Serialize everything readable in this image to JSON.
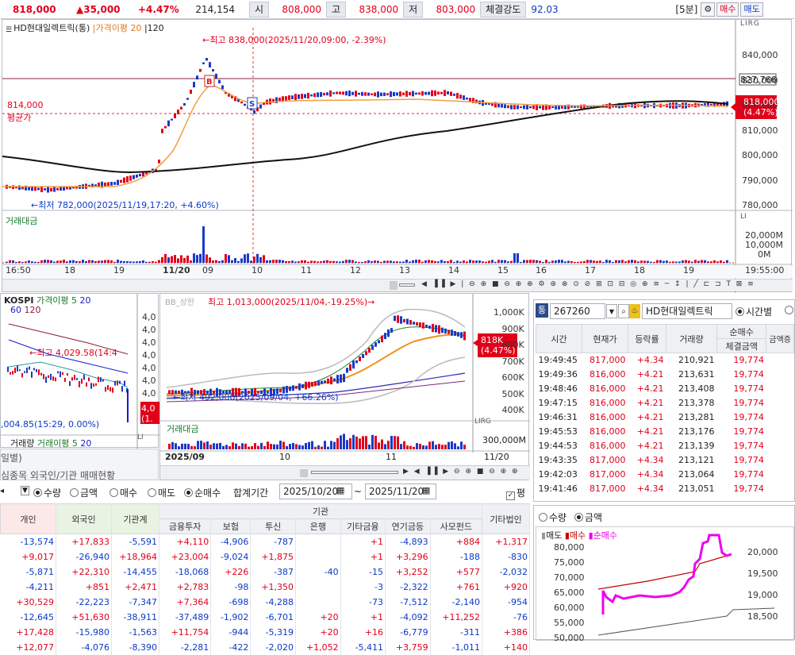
{
  "topbar": {
    "price": "818,000",
    "change": "▲35,000",
    "rate": "+4.47%",
    "volume": "214,154",
    "open_label": "시",
    "open": "808,000",
    "high_label": "고",
    "high": "838,000",
    "low_label": "저",
    "low": "803,000",
    "strength_label": "체결강도",
    "strength": "92.03",
    "interval": "[5분]",
    "buy": "매수",
    "sell": "매도"
  },
  "main_chart": {
    "title": "HD현대일렉트릭(통)",
    "ma_label": "가격이평",
    "ma_val": "20",
    "ma_val2": "120",
    "high_annot": "←최고 838,000(2025/11/20,09:00, -2.39%)",
    "low_annot": "←최저 782,000(2025/11/19,17:20, +4.60%)",
    "avg_value": "814,000",
    "avg_label": "평균가",
    "yaxis": [
      "840,000",
      "830,000",
      "820,000",
      "810,000",
      "800,000",
      "790,000",
      "780,000"
    ],
    "hline_label": "827,766",
    "cur_price": "818,000",
    "cur_rate": "(4.47%)",
    "axis_top": "LIRG",
    "vol_title": "거래대금",
    "vol_yaxis": [
      "20,000M",
      "10,000M",
      "0M"
    ],
    "xaxis": [
      "16:50",
      "18",
      "19",
      "11/20",
      "09",
      "10",
      "11",
      "12",
      "13",
      "14",
      "15",
      "16",
      "17",
      "18",
      "19",
      "19:55:00"
    ]
  },
  "kospi": {
    "title": "KOSPI",
    "ma_label": "가격이평",
    "ma1": "5",
    "ma2": "20",
    "ma3": "60",
    "ma4": "120",
    "high_annot": "←최고 4,029.58(14:4",
    "low_annot": ",004.85(15:29, 0.00%)",
    "yaxis": [
      "4,0",
      "4,0",
      "4,0",
      "4,0",
      "4,0",
      "4,0",
      "4,0"
    ],
    "cur": "4,0",
    "cur2": "(1.",
    "vol_title": "거래량",
    "vol_ma": "거래이평",
    "vol_ma1": "5",
    "vol_ma2": "20"
  },
  "daily": {
    "bb_label": "BB_상한",
    "high_annot": "최고 1,013,000(2025/11/04,-19.25%)→",
    "low_annot": "←최저 492,000(2025/09/04, +66.26%)",
    "yaxis": [
      "1,000K",
      "900K",
      "800K",
      "700K",
      "600K",
      "500K",
      "400K"
    ],
    "cur": "818K",
    "cur_rate": "(4.47%)",
    "vol_title": "거래대금",
    "vol_axis": "300,000M",
    "xaxis": [
      "2025/09",
      "10",
      "11",
      "11/20"
    ],
    "axis_top": "LIRG"
  },
  "tick": {
    "code": "267260",
    "name": "HD현대일렉트릭",
    "tab": "시간별",
    "headers": [
      "시간",
      "현재가",
      "등락률",
      "거래량",
      "순매수",
      "체결금액"
    ],
    "header_extra": "금액증",
    "rows": [
      [
        "19:49:45",
        "817,000",
        "+4.34",
        "210,921",
        "19,774"
      ],
      [
        "19:49:36",
        "816,000",
        "+4.21",
        "213,631",
        "19,774"
      ],
      [
        "19:48:46",
        "816,000",
        "+4.21",
        "213,408",
        "19,774"
      ],
      [
        "19:47:15",
        "816,000",
        "+4.21",
        "213,378",
        "19,774"
      ],
      [
        "19:46:31",
        "816,000",
        "+4.21",
        "213,281",
        "19,774"
      ],
      [
        "19:45:53",
        "816,000",
        "+4.21",
        "213,176",
        "19,774"
      ],
      [
        "19:44:53",
        "816,000",
        "+4.21",
        "213,139",
        "19,774"
      ],
      [
        "19:43:35",
        "817,000",
        "+4.34",
        "213,121",
        "19,774"
      ],
      [
        "19:42:03",
        "817,000",
        "+4.34",
        "213,064",
        "19,774"
      ],
      [
        "19:41:46",
        "817,000",
        "+4.34",
        "213,051",
        "19,774"
      ]
    ]
  },
  "flow": {
    "radio_qty": "수량",
    "radio_amt": "금액",
    "legend_sell": "매도",
    "legend_buy": "매수",
    "legend_net": "순매수",
    "yaxis_left": [
      "80,000",
      "75,000",
      "70,000",
      "65,000",
      "60,000",
      "55,000",
      "50,000"
    ],
    "yaxis_right": [
      "20,000",
      "19,500",
      "19,000",
      "18,500"
    ]
  },
  "investor": {
    "tab1": "일별)",
    "tab2": "심종목 외국인/기관 매매현황",
    "radios": [
      "수량",
      "금액",
      "매수",
      "매도",
      "순매수"
    ],
    "period_label": "합계기간",
    "date_from": "2025/10/20",
    "date_to": "2025/11/20",
    "tilde": "~",
    "check_label": "평",
    "group_label": "기관",
    "headers": [
      "개인",
      "외국인",
      "기관계",
      "금융투자",
      "보험",
      "투신",
      "은행",
      "기타금융",
      "연기금등",
      "사모펀드",
      "기타법인"
    ],
    "rows": [
      [
        "-13,574",
        "+17,833",
        "-5,591",
        "+4,110",
        "-4,906",
        "-787",
        "",
        "+1",
        "-4,893",
        "+884",
        "+1,317"
      ],
      [
        "+9,017",
        "-26,940",
        "+18,964",
        "+23,004",
        "-9,024",
        "+1,875",
        "",
        "+1",
        "+3,296",
        "-188",
        "-830"
      ],
      [
        "-5,871",
        "+22,310",
        "-14,455",
        "-18,068",
        "+226",
        "-387",
        "-40",
        "-15",
        "+3,252",
        "+577",
        "-2,032"
      ],
      [
        "-4,211",
        "+851",
        "+2,471",
        "+2,783",
        "-98",
        "+1,350",
        "",
        "-3",
        "-2,322",
        "+761",
        "+920"
      ],
      [
        "+30,529",
        "-22,223",
        "-7,347",
        "+7,364",
        "-698",
        "-4,288",
        "",
        "-73",
        "-7,512",
        "-2,140",
        "-954"
      ],
      [
        "-12,645",
        "+51,630",
        "-38,911",
        "-37,489",
        "-1,902",
        "-6,701",
        "+20",
        "+1",
        "-4,092",
        "+11,252",
        "-76"
      ],
      [
        "+17,428",
        "-15,980",
        "-1,563",
        "+11,754",
        "-944",
        "-5,319",
        "+20",
        "+16",
        "-6,779",
        "-311",
        "+386"
      ],
      [
        "+12,077",
        "-4,076",
        "-8,390",
        "-2,281",
        "-422",
        "-2,020",
        "+1,052",
        "-5,411",
        "+3,759",
        "-1,011",
        "+140"
      ]
    ]
  }
}
